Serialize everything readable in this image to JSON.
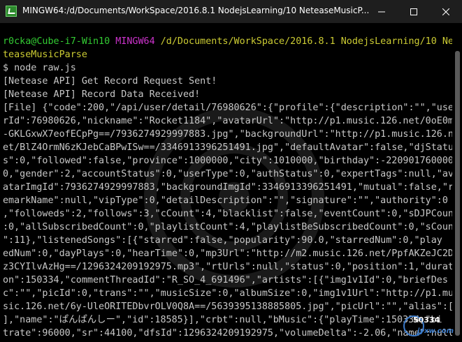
{
  "window": {
    "title": "MINGW64:/d/Documents/WorkSpace/2016.8.1 NodejsLearning/10 NeteaseMusicP...",
    "controls": [
      "minimize-icon",
      "maximize-icon",
      "close-icon"
    ]
  },
  "prompt": {
    "user_host": "r0cka@Cube-i7-Win10",
    "env": "MINGW64",
    "path_line1": "/d/Documents/WorkSpace/2016.8.1 NodejsLearning/10 Ne",
    "path_line2": "teaseMusicParse"
  },
  "terminal_lines": [
    "$ node raw.js",
    "[Netease API] Get Record Request Sent!",
    "[Netease API] Record Data Received!",
    "[File] {\"code\":200,\"/api/user/detail/76980626\":{\"profile\":{\"description\":\"\",\"use",
    "rId\":76980626,\"nickname\":\"Rocket1184\",\"avatarUrl\":\"http://p1.music.126.net/0oE0m",
    "-GKLGxwX7eofECpPg==/7936274929997883.jpg\",\"backgroundUrl\":\"http://p1.music.126.n",
    "et/BlZ4OrmN6zKJebCaBPwISw==/3346913396251491.jpg\",\"defaultAvatar\":false,\"djStatu",
    "s\":0,\"followed\":false,\"province\":1000000,\"city\":1010000,\"birthday\":-2209017600000",
    "0,\"gender\":2,\"accountStatus\":0,\"userType\":0,\"authStatus\":0,\"expertTags\":null,\"av",
    "atarImgId\":7936274929997883,\"backgroundImgId\":3346913396251491,\"mutual\":false,\"r",
    "emarkName\":null,\"vipType\":0,\"detailDescription\":\"\",\"signature\":\"\",\"authority\":0",
    ",\"followeds\":2,\"follows\":3,\"cCount\":4,\"blacklist\":false,\"eventCount\":0,\"sDJPCount",
    ":0,\"allSubscribedCount\":0,\"playlistCount\":4,\"playlistBeSubscribedCount\":0,\"sCount",
    "\":11},\"listenedSongs\":[{\"starred\":false,\"popularity\":90.0,\"starredNum\":0,\"play",
    "edNum\":0,\"dayPlays\":0,\"hearTime\":0,\"mp3Url\":\"http://m2.music.126.net/PpfAKZeJC2D",
    "z3CYIlvAzHg==/1296324209192975.mp3\",\"rtUrls\":null,\"status\":0,\"position\":1,\"durati",
    "on\":150334,\"commentThreadId\":\"R_SO_4_691496\",\"artists\":[{\"img1v1Id\":0,\"briefDes",
    "c\":\"\",\"picId\":0,\"trans\":\"\",\"musicSize\":0,\"albumSize\":0,\"img1v1Url\":\"http://p1.mu",
    "sic.126.net/6y-UleORITEDbvrOLV0Q8A==/5639395138885805.jpg\",\"picUrl\":\"\",\"alias\":[",
    "],\"name\":\"ぱんぱんしー\",\"id\":18585}],\"crbt\":null,\"bMusic\":{\"playTime\":150334,\"bi",
    "trate\":96000,\"sr\":44100,\"dfsId\":1296324209192975,\"volumeDelta\":-2.06,\"name\":null"
  ],
  "watermark": {
    "number": "50334",
    "site": "jyxw.com"
  },
  "colors": {
    "user_host": "#33cc33",
    "env": "#cc33cc",
    "path": "#cccc33",
    "text": "#c8c8c8",
    "background": "#000000",
    "titlebar": "#1e1e1e"
  }
}
